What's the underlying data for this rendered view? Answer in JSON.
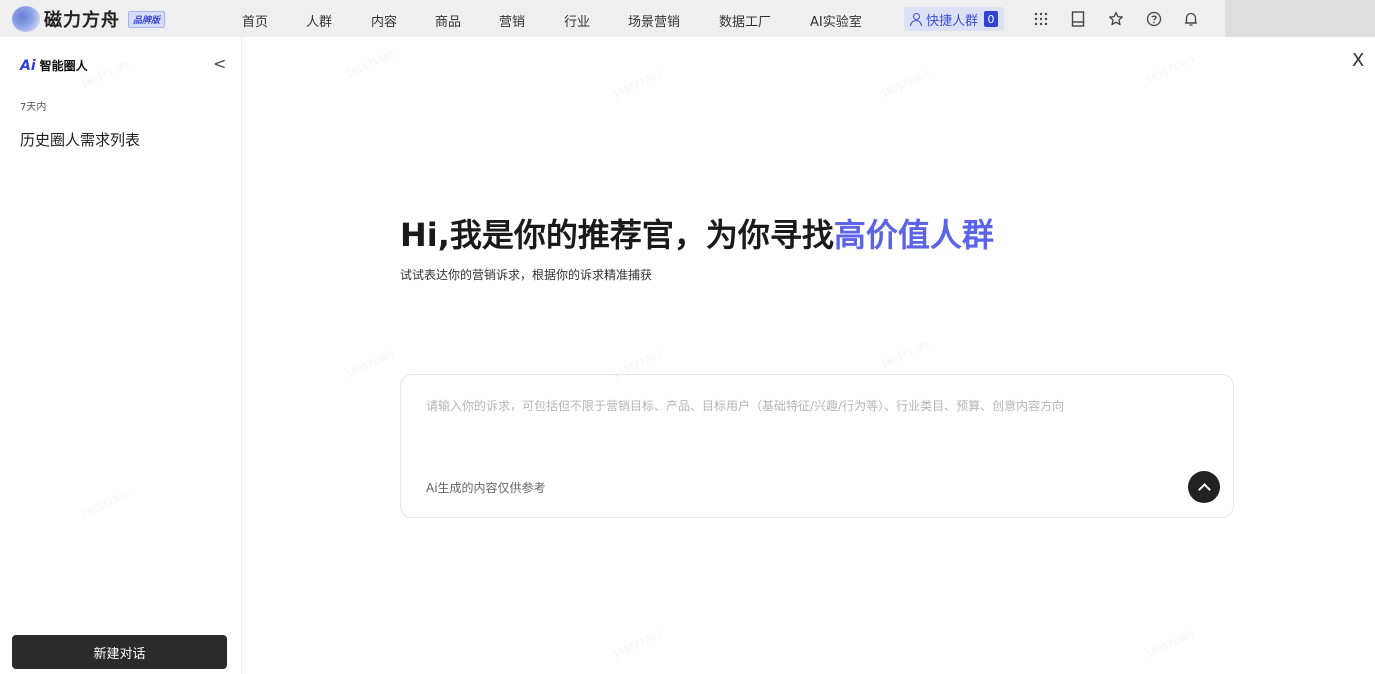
{
  "topnav": {
    "brand_name": "磁力方舟",
    "brand_tag": "品牌版",
    "items": [
      "首页",
      "人群",
      "内容",
      "商品",
      "营销",
      "行业",
      "场景营销",
      "数据工厂",
      "AI实验室"
    ],
    "quick_crowd_label": "快捷人群",
    "quick_crowd_count": "0"
  },
  "sidebar": {
    "ai_mark": "Ai",
    "title": "智能圈人",
    "collapse_glyph": "<",
    "group_label": "7天内",
    "items": [
      {
        "label": "历史圈人需求列表"
      }
    ],
    "new_chat_label": "新建对话"
  },
  "close_glyph": "X",
  "hero": {
    "title_prefix": "Hi,我是你的推荐官，为你寻找",
    "title_highlight": "高价值人群",
    "subtitle": "试试表达你的营销诉求，根据你的诉求精准捕获"
  },
  "input_card": {
    "placeholder": "请输入你的诉求，可包括但不限于营销目标、产品、目标用户（基础特征/兴趣/行为等）、行业类目、预算、创意内容方向",
    "value": "",
    "disclaimer": "Ai生成的内容仅供参考"
  },
  "watermark": "165571385"
}
